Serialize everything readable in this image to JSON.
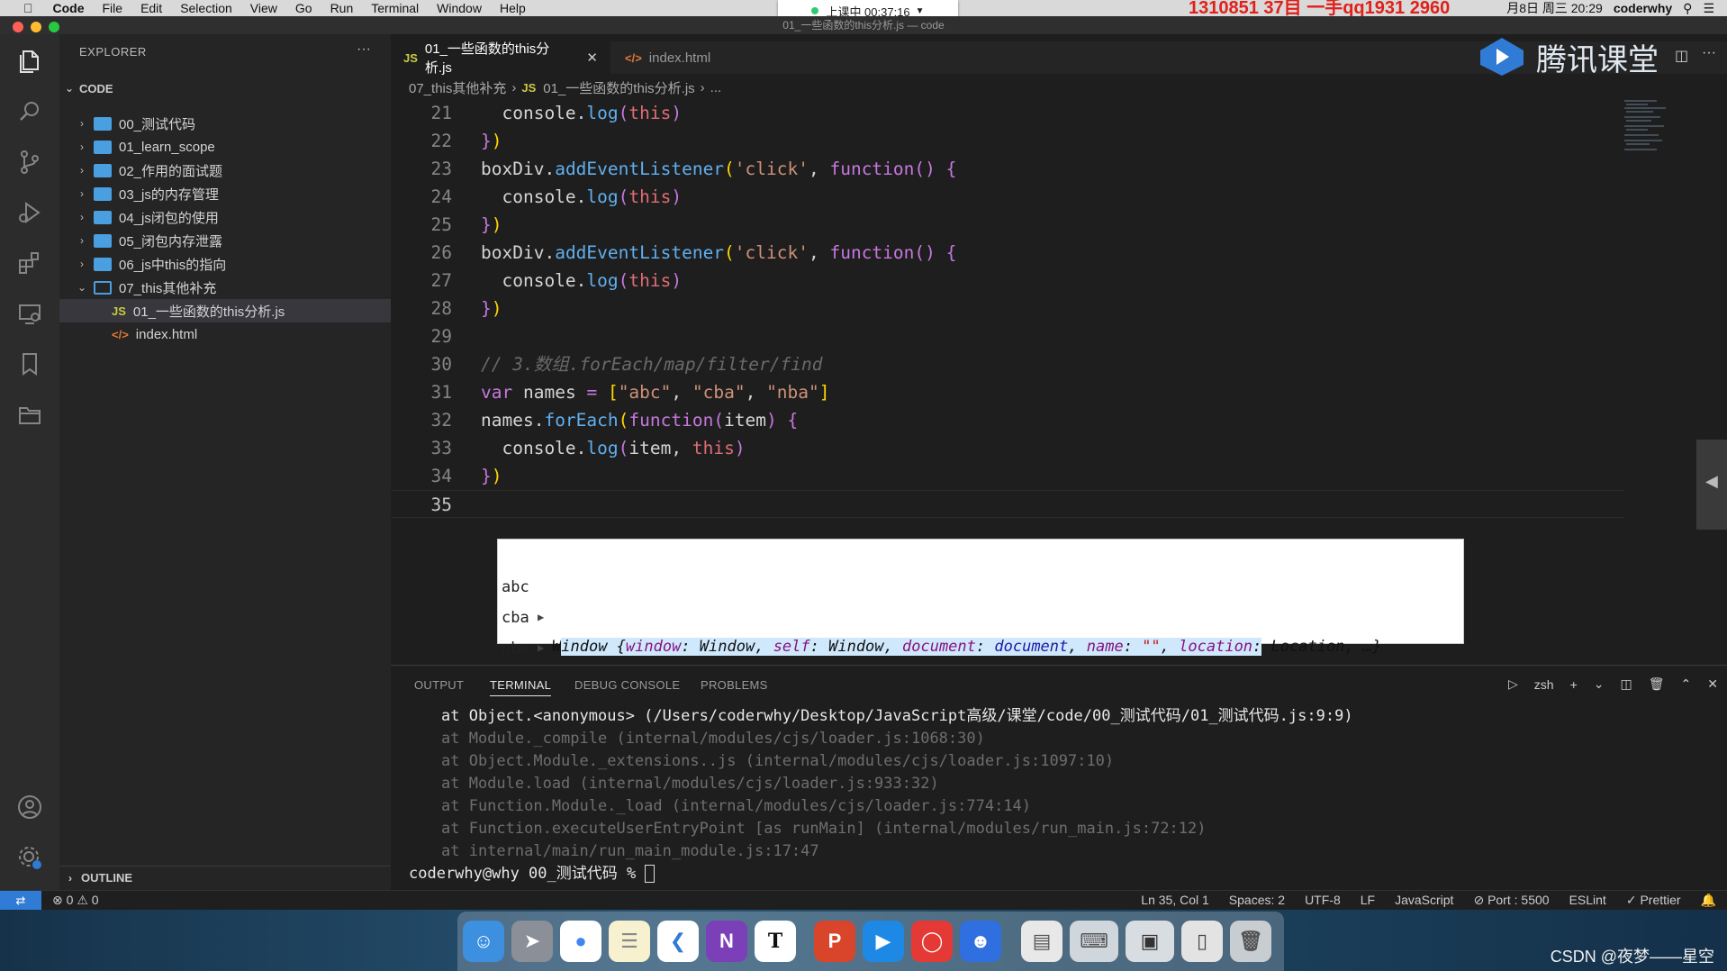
{
  "menubar": {
    "app": "Code",
    "items": [
      "File",
      "Edit",
      "Selection",
      "View",
      "Go",
      "Run",
      "Terminal",
      "Window",
      "Help"
    ],
    "recording": "上课中 00:37:16",
    "watermark": "1310851 37目 一手qq1931 2960",
    "date_time": "月8日 周三 20:29",
    "user": "coderwhy"
  },
  "window_title": "01_一些函数的this分析.js — code",
  "sidebar": {
    "title": "EXPLORER",
    "root": "CODE",
    "folders": [
      {
        "name": "00_测试代码",
        "open": false
      },
      {
        "name": "01_learn_scope",
        "open": false
      },
      {
        "name": "02_作用的面试题",
        "open": false
      },
      {
        "name": "03_js的内存管理",
        "open": false
      },
      {
        "name": "04_js闭包的使用",
        "open": false
      },
      {
        "name": "05_闭包内存泄露",
        "open": false
      },
      {
        "name": "06_js中this的指向",
        "open": false
      },
      {
        "name": "07_this其他补充",
        "open": true
      }
    ],
    "files": [
      {
        "name": "01_一些函数的this分析.js",
        "type": "JS"
      },
      {
        "name": "index.html",
        "type": "</>"
      }
    ],
    "outline": "OUTLINE"
  },
  "tabs": [
    {
      "label": "01_一些函数的this分析.js",
      "badge": "JS",
      "active": true
    },
    {
      "label": "index.html",
      "badge": "</>",
      "active": false
    }
  ],
  "breadcrumb": {
    "folder": "07_this其他补充",
    "badge": "JS",
    "file": "01_一些函数的this分析.js",
    "rest": "..."
  },
  "brand": "腾讯课堂",
  "editor": {
    "line_numbers": [
      "21",
      "22",
      "23",
      "24",
      "25",
      "26",
      "27",
      "28",
      "29",
      "30",
      "31",
      "32",
      "33",
      "34",
      "35"
    ]
  },
  "console_popup": {
    "rows": [
      {
        "label": "abc"
      },
      {
        "label": "cba"
      },
      {
        "label": "nba"
      }
    ],
    "object_text": "Window {window: Window, self: Window, document: document, name: \"\", location: Location, …}"
  },
  "panel": {
    "tabs": [
      "OUTPUT",
      "TERMINAL",
      "DEBUG CONSOLE",
      "PROBLEMS"
    ],
    "active_tab": "TERMINAL",
    "shell": "zsh",
    "terminal_lines": [
      {
        "text": "at Object.<anonymous> (/Users/coderwhy/Desktop/JavaScript高级/课堂/code/00_测试代码/01_测试代码.js:9:9)",
        "bright": true
      },
      {
        "text": "at Module._compile (internal/modules/cjs/loader.js:1068:30)",
        "bright": false
      },
      {
        "text": "at Object.Module._extensions..js (internal/modules/cjs/loader.js:1097:10)",
        "bright": false
      },
      {
        "text": "at Module.load (internal/modules/cjs/loader.js:933:32)",
        "bright": false
      },
      {
        "text": "at Function.Module._load (internal/modules/cjs/loader.js:774:14)",
        "bright": false
      },
      {
        "text": "at Function.executeUserEntryPoint [as runMain] (internal/modules/run_main.js:72:12)",
        "bright": false
      },
      {
        "text": "at internal/main/run_main_module.js:17:47",
        "bright": false
      }
    ],
    "prompt": "coderwhy@why 00_测试代码 % "
  },
  "statusbar": {
    "errors": "0",
    "warnings": "0",
    "position": "Ln 35, Col 1",
    "spaces": "Spaces: 2",
    "encoding": "UTF-8",
    "eol": "LF",
    "language": "JavaScript",
    "port": "Port : 5500",
    "eslint": "ESLint",
    "prettier": "Prettier"
  },
  "csdn": "CSDN @夜梦——星空"
}
